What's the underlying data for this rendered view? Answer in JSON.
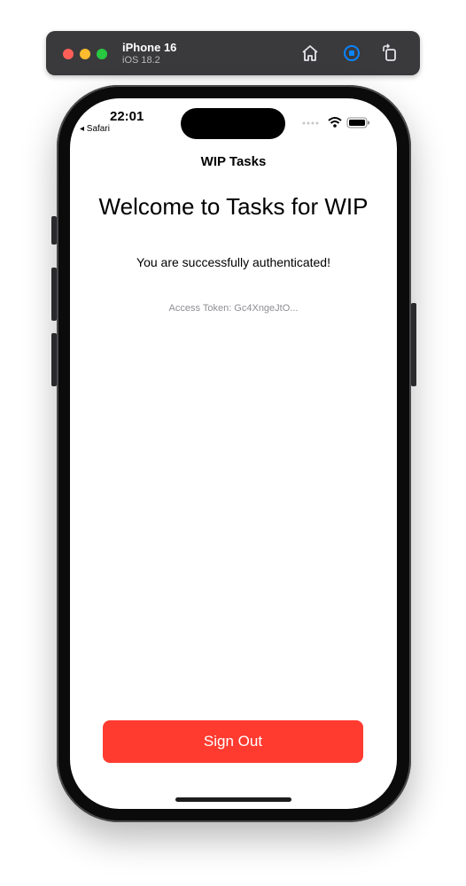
{
  "simulator": {
    "device_name": "iPhone 16",
    "os_version": "iOS 18.2",
    "toolbar_icons": [
      "home-icon",
      "stop-icon",
      "rotate-icon"
    ]
  },
  "status_bar": {
    "time": "22:01",
    "back_app": "◂ Safari"
  },
  "nav": {
    "title": "WIP Tasks"
  },
  "main": {
    "welcome": "Welcome to Tasks for WIP",
    "auth_message": "You are successfully authenticated!",
    "token": "Access Token: Gc4XngeJtO..."
  },
  "actions": {
    "sign_out": "Sign Out"
  },
  "colors": {
    "accent": "#ff3b30",
    "toolbar": "#3a3a3c",
    "stop_icon": "#0a84ff"
  }
}
